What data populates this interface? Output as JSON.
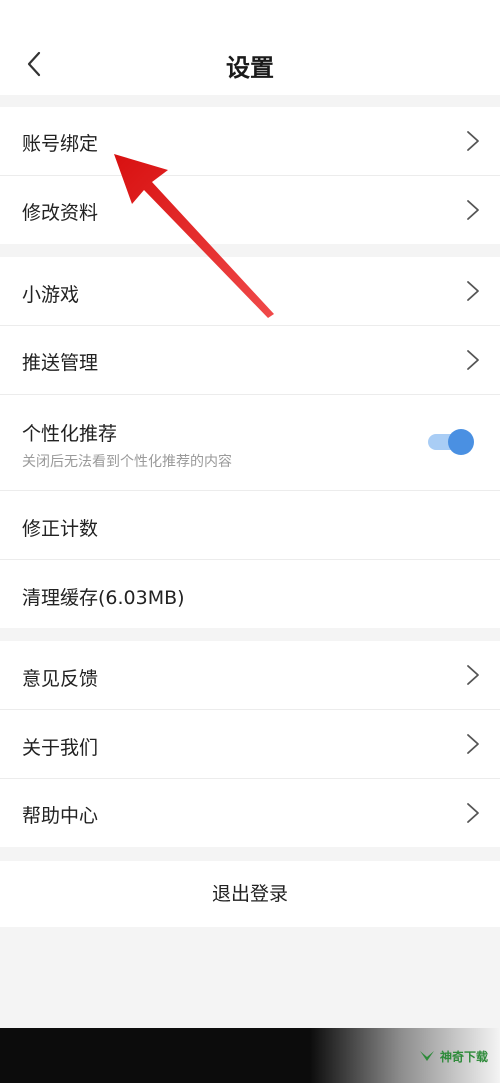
{
  "header": {
    "title": "设置",
    "back_icon": "chevron-left-icon"
  },
  "groups": [
    {
      "items": [
        {
          "label": "账号绑定",
          "chevron": true
        },
        {
          "label": "修改资料",
          "chevron": true
        }
      ]
    },
    {
      "items": [
        {
          "label": "小游戏",
          "chevron": true
        },
        {
          "label": "推送管理",
          "chevron": true
        },
        {
          "label": "个性化推荐",
          "sublabel": "关闭后无法看到个性化推荐的内容",
          "toggle_on": true
        },
        {
          "label": "修正计数",
          "chevron": false
        },
        {
          "label": "清理缓存(6.03MB)",
          "chevron": false
        }
      ]
    },
    {
      "items": [
        {
          "label": "意见反馈",
          "chevron": true
        },
        {
          "label": "关于我们",
          "chevron": true
        },
        {
          "label": "帮助中心",
          "chevron": true
        }
      ]
    }
  ],
  "logout": {
    "label": "退出登录"
  },
  "watermark": {
    "text": "神奇下载"
  },
  "colors": {
    "accent": "#4a90e2",
    "annotation_arrow": "#e02020",
    "background": "#f4f4f4"
  }
}
